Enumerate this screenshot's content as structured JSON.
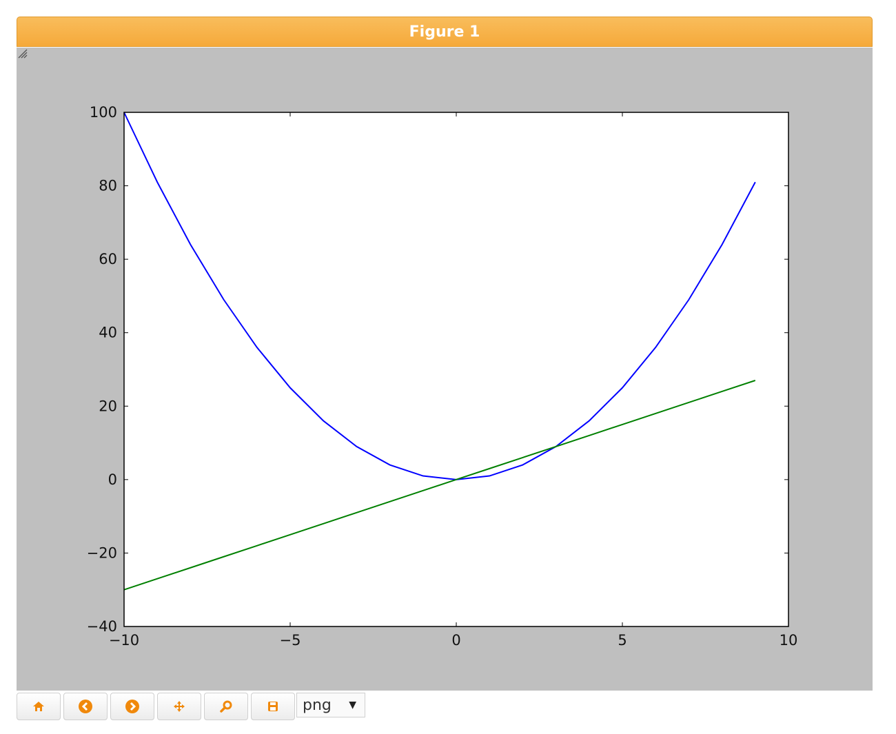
{
  "figure": {
    "title": "Figure 1"
  },
  "toolbar": {
    "buttons": [
      {
        "name": "home-button",
        "icon": "home-icon"
      },
      {
        "name": "back-button",
        "icon": "arrow-left-circle-icon"
      },
      {
        "name": "forward-button",
        "icon": "arrow-right-circle-icon"
      },
      {
        "name": "pan-button",
        "icon": "move-arrows-icon"
      },
      {
        "name": "zoom-button",
        "icon": "magnifier-icon"
      },
      {
        "name": "save-button",
        "icon": "floppy-disk-icon"
      }
    ],
    "format_selected": "png",
    "accent_color": "#f0890c"
  },
  "chart_data": {
    "type": "line",
    "title": "",
    "xlabel": "",
    "ylabel": "",
    "xlim": [
      -10,
      10
    ],
    "ylim": [
      -40,
      100
    ],
    "xticks": [
      -10,
      -5,
      0,
      5,
      10
    ],
    "xtick_labels": [
      "−10",
      "−5",
      "0",
      "5",
      "10"
    ],
    "yticks": [
      -40,
      -20,
      0,
      20,
      40,
      60,
      80,
      100
    ],
    "ytick_labels": [
      "−40",
      "−20",
      "0",
      "20",
      "40",
      "60",
      "80",
      "100"
    ],
    "grid": false,
    "x": [
      -10,
      -9,
      -8,
      -7,
      -6,
      -5,
      -4,
      -3,
      -2,
      -1,
      0,
      1,
      2,
      3,
      4,
      5,
      6,
      7,
      8,
      9
    ],
    "series": [
      {
        "color": "#0000ff",
        "values": [
          100,
          81,
          64,
          49,
          36,
          25,
          16,
          9,
          4,
          1,
          0,
          1,
          4,
          9,
          16,
          25,
          36,
          49,
          64,
          81
        ]
      },
      {
        "color": "#008000",
        "values": [
          -30,
          -27,
          -24,
          -21,
          -18,
          -15,
          -12,
          -9,
          -6,
          -3,
          0,
          3,
          6,
          9,
          12,
          15,
          18,
          21,
          24,
          27
        ]
      }
    ]
  }
}
